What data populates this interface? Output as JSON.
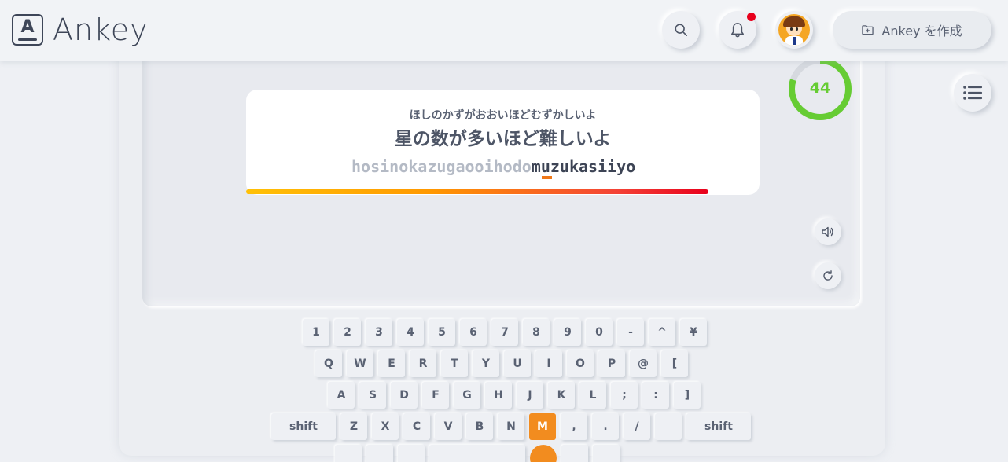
{
  "header": {
    "logo_mark": "A",
    "logo_text": "Ankey",
    "create_button_label": "Ankey を作成"
  },
  "prompt": {
    "kana": "ほしのかずがおおいほどむずかしいよ",
    "kanji": "星の数が多いほど難しいよ",
    "typed": "hosinokazugaooihodo",
    "remaining": "muzukasiiyo"
  },
  "score": {
    "value": "44",
    "ring_fraction": 0.8,
    "ring_color": "#66cc33"
  },
  "progress": {
    "fraction": 0.9
  },
  "keyboard": {
    "row1": [
      "1",
      "2",
      "3",
      "4",
      "5",
      "6",
      "7",
      "8",
      "9",
      "0",
      "-",
      "^",
      "¥"
    ],
    "row2": [
      "Q",
      "W",
      "E",
      "R",
      "T",
      "Y",
      "U",
      "I",
      "O",
      "P",
      "@",
      "["
    ],
    "row3": [
      "A",
      "S",
      "D",
      "F",
      "G",
      "H",
      "J",
      "K",
      "L",
      ";",
      ":",
      "]"
    ],
    "row4": [
      "shift",
      "Z",
      "X",
      "C",
      "V",
      "B",
      "N",
      "M",
      ",",
      ".",
      "/",
      "",
      "shift"
    ],
    "active_key": "M"
  },
  "colors": {
    "accent": "#f28c1f",
    "notification": "#e8001c",
    "score_green": "#66cc33"
  },
  "icons": {
    "search": "search-icon",
    "bell": "bell-icon",
    "create": "folder-plus-icon",
    "list": "list-icon",
    "sound": "speaker-icon",
    "reset": "refresh-icon"
  }
}
